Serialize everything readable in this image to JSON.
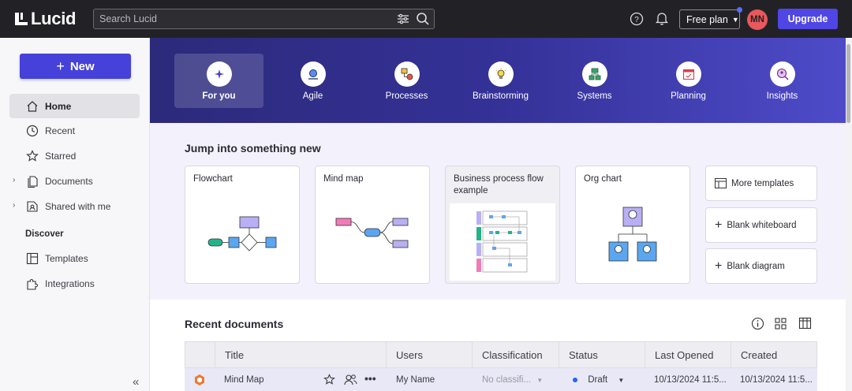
{
  "app": {
    "name": "Lucid"
  },
  "header": {
    "search_placeholder": "Search Lucid",
    "plan_label": "Free plan",
    "avatar_initials": "MN",
    "upgrade_label": "Upgrade"
  },
  "sidebar": {
    "new_label": "New",
    "items": [
      {
        "label": "Home"
      },
      {
        "label": "Recent"
      },
      {
        "label": "Starred"
      },
      {
        "label": "Documents"
      },
      {
        "label": "Shared with me"
      }
    ],
    "discover_label": "Discover",
    "discover_items": [
      {
        "label": "Templates"
      },
      {
        "label": "Integrations"
      }
    ]
  },
  "categories": [
    {
      "label": "For you",
      "icon": "sparkle-icon"
    },
    {
      "label": "Agile",
      "icon": "agile-icon"
    },
    {
      "label": "Processes",
      "icon": "process-icon"
    },
    {
      "label": "Brainstorming",
      "icon": "lightbulb-icon"
    },
    {
      "label": "Systems",
      "icon": "systems-icon"
    },
    {
      "label": "Planning",
      "icon": "calendar-icon"
    },
    {
      "label": "Insights",
      "icon": "insights-icon"
    }
  ],
  "jump": {
    "title": "Jump into something new",
    "cards": [
      {
        "label": "Flowchart"
      },
      {
        "label": "Mind map"
      },
      {
        "label": "Business process flow example"
      },
      {
        "label": "Org chart"
      }
    ],
    "side_buttons": [
      {
        "label": "More templates"
      },
      {
        "label": "Blank whiteboard"
      },
      {
        "label": "Blank diagram"
      }
    ]
  },
  "recent": {
    "title": "Recent documents",
    "columns": [
      "Title",
      "Users",
      "Classification",
      "Status",
      "Last Opened",
      "Created"
    ],
    "rows": [
      {
        "title": "Mind Map",
        "users": "My Name",
        "classification": "No classifi...",
        "status": "Draft",
        "last_opened": "10/13/2024 11:5...",
        "created": "10/13/2024 11:5..."
      }
    ]
  },
  "colors": {
    "accent": "#4f46e5",
    "topbar": "#222226",
    "banner": "#343197",
    "status_dot": "#2563eb"
  }
}
